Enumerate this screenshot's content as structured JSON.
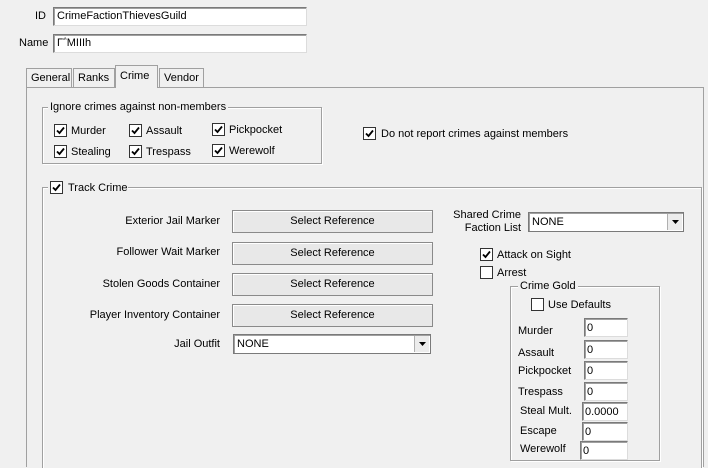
{
  "header": {
    "id_label": "ID",
    "id_value": "CrimeFactionThievesGuild",
    "name_label": "Name",
    "name_value": "Γ΅ΜΙΙΙh"
  },
  "tabs": [
    {
      "label": "General",
      "active": false
    },
    {
      "label": "Ranks",
      "active": false
    },
    {
      "label": "Crime",
      "active": true
    },
    {
      "label": "Vendor",
      "active": false
    }
  ],
  "ignore_crimes": {
    "title": "Ignore crimes against non-members",
    "items": [
      {
        "label": "Murder",
        "checked": true
      },
      {
        "label": "Assault",
        "checked": true
      },
      {
        "label": "Pickpocket",
        "checked": true
      },
      {
        "label": "Stealing",
        "checked": true
      },
      {
        "label": "Trespass",
        "checked": true
      },
      {
        "label": "Werewolf",
        "checked": true
      }
    ]
  },
  "do_not_report": {
    "label": "Do not report crimes against members",
    "checked": true
  },
  "track_crime": {
    "label": "Track Crime",
    "checked": true,
    "references": [
      {
        "label": "Exterior Jail Marker",
        "button": "Select Reference"
      },
      {
        "label": "Follower Wait Marker",
        "button": "Select Reference"
      },
      {
        "label": "Stolen Goods Container",
        "button": "Select Reference"
      },
      {
        "label": "Player Inventory Container",
        "button": "Select Reference"
      }
    ],
    "jail_outfit": {
      "label": "Jail Outfit",
      "value": "NONE"
    },
    "shared_crime": {
      "label_line1": "Shared Crime",
      "label_line2": "Faction List",
      "value": "NONE"
    },
    "attack_on_sight": {
      "label": "Attack on Sight",
      "checked": true
    },
    "arrest": {
      "label": "Arrest",
      "checked": false
    }
  },
  "crime_gold": {
    "title": "Crime Gold",
    "use_defaults": {
      "label": "Use Defaults",
      "checked": false
    },
    "fields": [
      {
        "label": "Murder",
        "value": "0"
      },
      {
        "label": "Assault",
        "value": "0"
      },
      {
        "label": "Pickpocket",
        "value": "0"
      },
      {
        "label": "Trespass",
        "value": "0"
      },
      {
        "label": "Steal Mult.",
        "value": "0.0000"
      },
      {
        "label": "Escape",
        "value": "0"
      },
      {
        "label": "Werewolf",
        "value": "0"
      }
    ]
  },
  "icons": {
    "checkmark": "checkmark-icon",
    "dropdown": "chevron-down-icon"
  }
}
